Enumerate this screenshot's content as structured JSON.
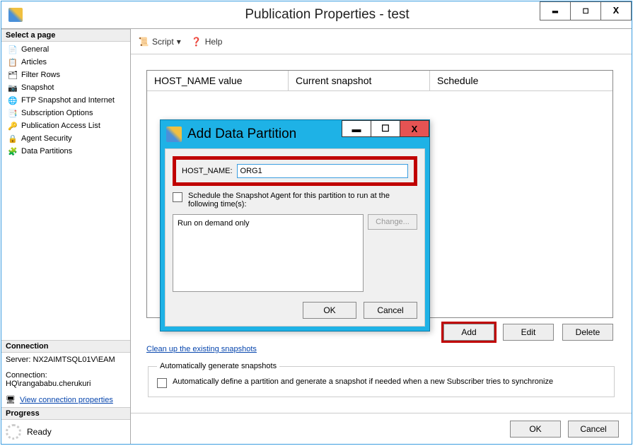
{
  "window": {
    "title": "Publication Properties - test",
    "buttons": {
      "min": "▬",
      "max": "☐",
      "close": "X"
    }
  },
  "sidebar": {
    "select_page_hdr": "Select a page",
    "items": [
      {
        "label": "General"
      },
      {
        "label": "Articles"
      },
      {
        "label": "Filter Rows"
      },
      {
        "label": "Snapshot"
      },
      {
        "label": "FTP Snapshot and Internet"
      },
      {
        "label": "Subscription Options"
      },
      {
        "label": "Publication Access List"
      },
      {
        "label": "Agent Security"
      },
      {
        "label": "Data Partitions"
      }
    ],
    "connection_hdr": "Connection",
    "server_label": "Server: NX2AIMTSQL01V\\EAM",
    "conn_label": "Connection:",
    "conn_value": "HQ\\rangababu.cherukuri",
    "view_props": "View connection properties",
    "progress_hdr": "Progress",
    "progress_status": "Ready"
  },
  "toolbar": {
    "script_label": "Script",
    "help_label": "Help"
  },
  "grid": {
    "col1": "HOST_NAME value",
    "col2": "Current snapshot",
    "col3": "Schedule"
  },
  "buttons": {
    "add": "Add",
    "edit": "Edit",
    "delete": "Delete",
    "ok": "OK",
    "cancel": "Cancel"
  },
  "cleanup_link": "Clean up the existing snapshots",
  "fieldset": {
    "legend": "Automatically generate snapshots",
    "checkbox_label": "Automatically define a partition and generate a snapshot if needed when a new Subscriber tries to synchronize"
  },
  "modal": {
    "title": "Add Data Partition",
    "host_label": "HOST_NAME:",
    "host_value": "ORG1",
    "sched_checkbox": "Schedule the Snapshot Agent for this partition to run at the following time(s):",
    "sched_text": "Run on demand only",
    "change": "Change...",
    "ok": "OK",
    "cancel": "Cancel"
  }
}
